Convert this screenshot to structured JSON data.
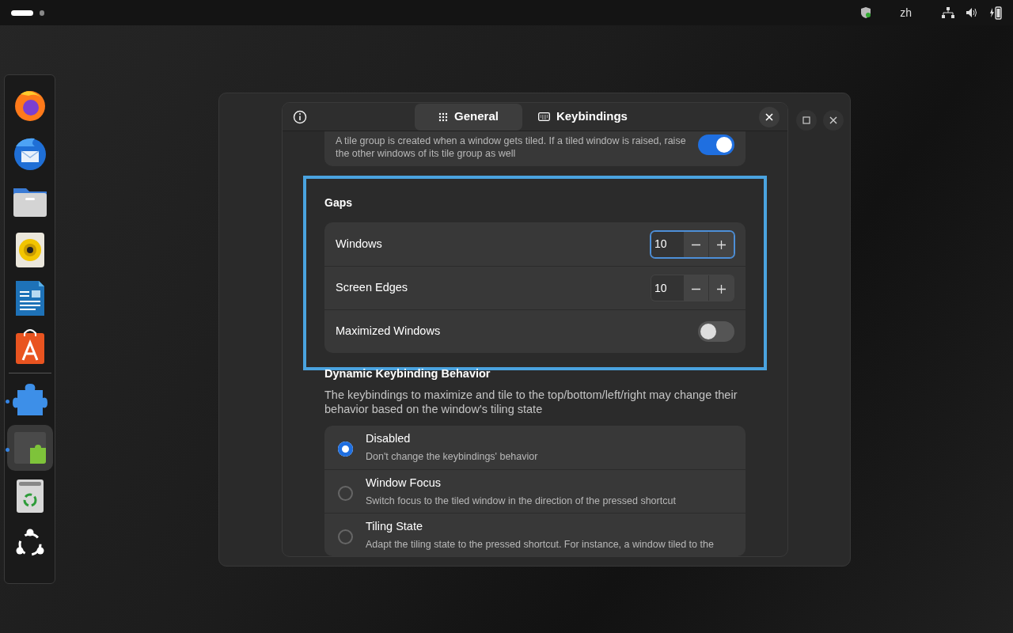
{
  "top_bar": {
    "workspaces": [
      {
        "selected": true
      },
      {
        "selected": false
      }
    ],
    "input_source": "zh"
  },
  "dock": {
    "items": [
      {
        "kind": "browser",
        "running": false,
        "selected": false
      },
      {
        "kind": "mail",
        "running": false,
        "selected": false
      },
      {
        "kind": "files",
        "running": false,
        "selected": false
      },
      {
        "kind": "music",
        "running": false,
        "selected": false
      },
      {
        "kind": "document",
        "running": false,
        "selected": false
      },
      {
        "kind": "store",
        "running": false,
        "selected": false
      },
      {
        "kind": "separator"
      },
      {
        "kind": "puzzle",
        "running": true,
        "selected": false
      },
      {
        "kind": "tiles",
        "running": true,
        "selected": true
      },
      {
        "kind": "trash",
        "running": false,
        "selected": false
      },
      {
        "kind": "logo",
        "running": false,
        "selected": false
      }
    ]
  },
  "dialog": {
    "tabs": [
      {
        "label": "General",
        "selected": true
      },
      {
        "label": "Keybindings",
        "selected": false
      }
    ],
    "top_row": {
      "description": "A tile group is created when a window gets tiled. If a tiled window is raised, raise the other windows of its tile group as well",
      "on": true
    },
    "gaps": {
      "title": "Gaps",
      "highlighted": true,
      "rows": [
        {
          "kind": "spin",
          "label": "Windows",
          "value": "10",
          "focused": true
        },
        {
          "kind": "spin",
          "label": "Screen Edges",
          "value": "10",
          "focused": false
        },
        {
          "kind": "switch",
          "label": "Maximized Windows",
          "on": false
        }
      ]
    },
    "dynamic": {
      "title": "Dynamic Keybinding Behavior",
      "description": "The keybindings to maximize and tile to the top/bottom/left/right may change their behavior based on the window's tiling state",
      "options": [
        {
          "label": "Disabled",
          "description": "Don't change the keybindings' behavior",
          "selected": true
        },
        {
          "label": "Window Focus",
          "description": "Switch focus to the tiled window in the direction of the pressed shortcut",
          "selected": false
        },
        {
          "label": "Tiling State",
          "description": "Adapt the tiling state to the pressed shortcut. For instance, a window tiled to the",
          "selected": false
        }
      ]
    }
  }
}
